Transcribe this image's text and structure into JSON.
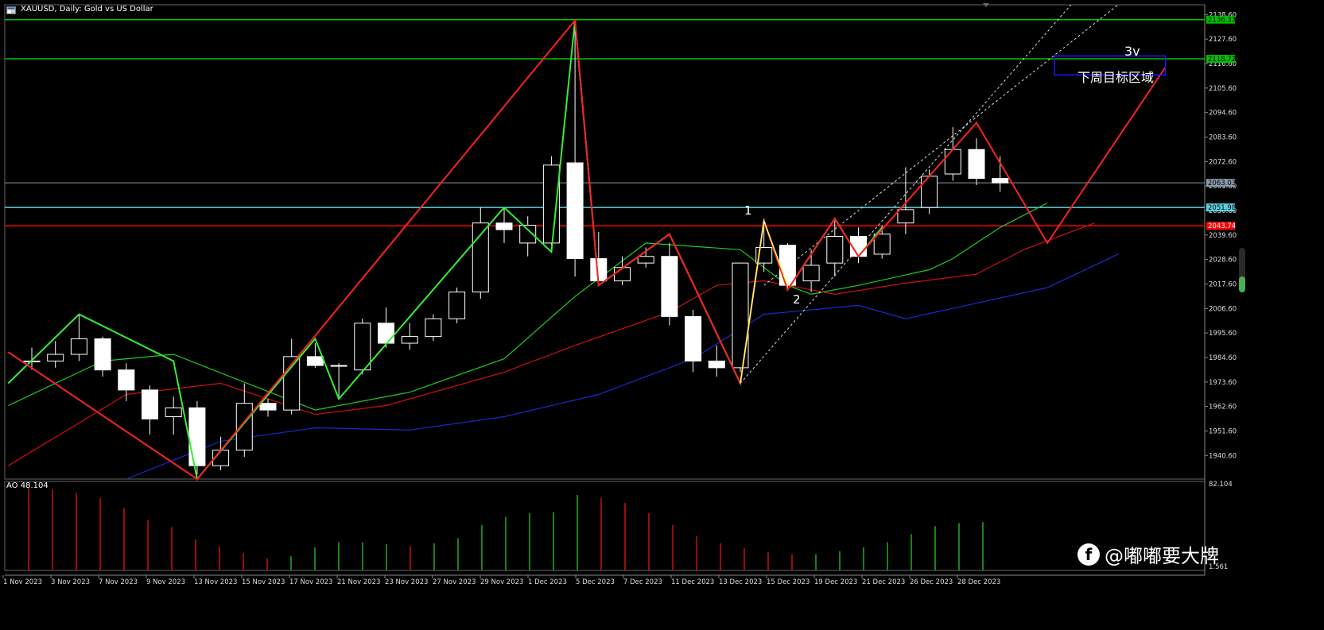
{
  "header": {
    "title": "XAUUSD, Daily:  Gold vs US Dollar",
    "icon": "chart-window-icon"
  },
  "ao_label": "AO 48.104",
  "watermark": {
    "icon": "facebook-icon",
    "text": "@嘟嘟要大牌"
  },
  "annotations": {
    "wave1": "1",
    "wave2": "2",
    "wave3": "3v",
    "target_zone": "下周目标区域"
  },
  "colors": {
    "background": "#000000",
    "grid": "#1a1a1a",
    "bull_candle": "#ffffff",
    "bear_candle": "#ffffff",
    "candle_wick": "#ffffff",
    "zigzag_red": "#ff2020",
    "zigzag_green": "#33ee33",
    "wave_yellow": "#ffff66",
    "ma_fast": "#22cc22",
    "ma_mid": "#cc1111",
    "ma_slow": "#1a2ad0",
    "level_green": "#00c000",
    "level_cyan": "#5ed0e0",
    "level_red": "#ff0000",
    "level_gray": "#8899aa",
    "target_box": "#1a1aff",
    "ao_up": "#22aa22",
    "ao_down": "#cc1111"
  },
  "chart_data": {
    "type": "candlestick",
    "symbol": "XAUUSD",
    "timeframe": "Daily",
    "y_axis": {
      "ylim": [
        1930.0,
        2143.0
      ],
      "ticks": [
        "2138.60",
        "2127.60",
        "2116.60",
        "2105.60",
        "2094.60",
        "2083.60",
        "2072.60",
        "2061.60",
        "2050.60",
        "2039.60",
        "2028.60",
        "2017.60",
        "2006.60",
        "1995.60",
        "1984.60",
        "1973.60",
        "1962.60",
        "1951.60",
        "1940.60"
      ]
    },
    "x_axis_labels": [
      "1 Nov 2023",
      "3 Nov 2023",
      "7 Nov 2023",
      "9 Nov 2023",
      "13 Nov 2023",
      "15 Nov 2023",
      "17 Nov 2023",
      "21 Nov 2023",
      "23 Nov 2023",
      "27 Nov 2023",
      "29 Nov 2023",
      "1 Dec 2023",
      "5 Dec 2023",
      "7 Dec 2023",
      "11 Dec 2023",
      "13 Dec 2023",
      "15 Dec 2023",
      "19 Dec 2023",
      "21 Dec 2023",
      "26 Dec 2023",
      "28 Dec 2023"
    ],
    "horizontal_levels": [
      {
        "label": "2136.33",
        "value": 2136.33,
        "color": "#00c000"
      },
      {
        "label": "2118.72",
        "value": 2118.72,
        "color": "#00c000"
      },
      {
        "label": "2063.03",
        "value": 2063.03,
        "color": "#8899aa"
      },
      {
        "label": "2051.98",
        "value": 2051.98,
        "color": "#5ed0e0"
      },
      {
        "label": "2043.74",
        "value": 2043.74,
        "color": "#ff0000"
      }
    ],
    "candles": [
      {
        "o": 1983,
        "h": 1989,
        "l": 1979,
        "c": 1983
      },
      {
        "o": 1983,
        "h": 1992,
        "l": 1980,
        "c": 1986
      },
      {
        "o": 1986,
        "h": 2004,
        "l": 1983,
        "c": 1993
      },
      {
        "o": 1993,
        "h": 1994,
        "l": 1976,
        "c": 1979
      },
      {
        "o": 1979,
        "h": 1982,
        "l": 1965,
        "c": 1970
      },
      {
        "o": 1970,
        "h": 1972,
        "l": 1950,
        "c": 1957
      },
      {
        "o": 1958,
        "h": 1967,
        "l": 1950,
        "c": 1962
      },
      {
        "o": 1962,
        "h": 1965,
        "l": 1932,
        "c": 1936
      },
      {
        "o": 1936,
        "h": 1949,
        "l": 1934,
        "c": 1943
      },
      {
        "o": 1943,
        "h": 1973,
        "l": 1940,
        "c": 1964
      },
      {
        "o": 1964,
        "h": 1966,
        "l": 1958,
        "c": 1961
      },
      {
        "o": 1961,
        "h": 1993,
        "l": 1959,
        "c": 1985
      },
      {
        "o": 1985,
        "h": 1991,
        "l": 1980,
        "c": 1981
      },
      {
        "o": 1981,
        "h": 1982,
        "l": 1966,
        "c": 1981
      },
      {
        "o": 1979,
        "h": 2002,
        "l": 1977,
        "c": 2000
      },
      {
        "o": 2000,
        "h": 2007,
        "l": 1989,
        "c": 1991
      },
      {
        "o": 1991,
        "h": 2000,
        "l": 1988,
        "c": 1994
      },
      {
        "o": 1994,
        "h": 2004,
        "l": 1992,
        "c": 2002
      },
      {
        "o": 2002,
        "h": 2016,
        "l": 2000,
        "c": 2014
      },
      {
        "o": 2014,
        "h": 2052,
        "l": 2011,
        "c": 2045
      },
      {
        "o": 2045,
        "h": 2052,
        "l": 2036,
        "c": 2042
      },
      {
        "o": 2036,
        "h": 2048,
        "l": 2030,
        "c": 2044
      },
      {
        "o": 2036,
        "h": 2075,
        "l": 2035,
        "c": 2071
      },
      {
        "o": 2072,
        "h": 2136,
        "l": 2021,
        "c": 2029
      },
      {
        "o": 2029,
        "h": 2041,
        "l": 2017,
        "c": 2019
      },
      {
        "o": 2019,
        "h": 2030,
        "l": 2017,
        "c": 2025
      },
      {
        "o": 2027,
        "h": 2034,
        "l": 2025,
        "c": 2030
      },
      {
        "o": 2030,
        "h": 2036,
        "l": 1999,
        "c": 2003
      },
      {
        "o": 2003,
        "h": 2006,
        "l": 1978,
        "c": 1983
      },
      {
        "o": 1983,
        "h": 1990,
        "l": 1976,
        "c": 1980
      },
      {
        "o": 1980,
        "h": 2027,
        "l": 1978,
        "c": 2027
      },
      {
        "o": 2027,
        "h": 2047,
        "l": 2023,
        "c": 2034
      },
      {
        "o": 2035,
        "h": 2036,
        "l": 2015,
        "c": 2017
      },
      {
        "o": 2019,
        "h": 2033,
        "l": 2014,
        "c": 2026
      },
      {
        "o": 2027,
        "h": 2046,
        "l": 2021,
        "c": 2039
      },
      {
        "o": 2039,
        "h": 2043,
        "l": 2027,
        "c": 2030
      },
      {
        "o": 2031,
        "h": 2044,
        "l": 2029,
        "c": 2040
      },
      {
        "o": 2045,
        "h": 2070,
        "l": 2040,
        "c": 2051
      },
      {
        "o": 2052,
        "h": 2069,
        "l": 2049,
        "c": 2066
      },
      {
        "o": 2067,
        "h": 2088,
        "l": 2064,
        "c": 2078
      },
      {
        "o": 2078,
        "h": 2083,
        "l": 2062,
        "c": 2065
      },
      {
        "o": 2065,
        "h": 2075,
        "l": 2059,
        "c": 2063
      }
    ],
    "zigzag": [
      {
        "color": "#33ee33",
        "points": [
          [
            -1,
            1973
          ],
          [
            2,
            2004
          ],
          [
            6,
            1983
          ],
          [
            7,
            1930
          ],
          [
            12,
            1993
          ],
          [
            13,
            1966
          ],
          [
            20,
            2052
          ],
          [
            22,
            2032
          ],
          [
            23,
            2136
          ],
          [
            24,
            2017
          ],
          [
            27,
            2040
          ],
          [
            30,
            1973
          ],
          [
            31,
            2046
          ],
          [
            32,
            2015
          ],
          [
            34,
            2047
          ],
          [
            35,
            2030
          ],
          [
            36,
            2043
          ]
        ]
      },
      {
        "color": "#ff2020",
        "points": [
          [
            -1,
            1987
          ],
          [
            7,
            1930
          ],
          [
            23,
            2136
          ],
          [
            24,
            2017
          ],
          [
            27,
            2040
          ],
          [
            30,
            1973
          ],
          [
            31,
            2046
          ],
          [
            32,
            2015
          ],
          [
            34,
            2047
          ],
          [
            35,
            2030
          ],
          [
            40,
            2090
          ],
          [
            43,
            2036
          ],
          [
            48,
            2115
          ]
        ]
      }
    ],
    "moving_averages": [
      {
        "color": "#22cc22",
        "points": [
          [
            -1,
            1963
          ],
          [
            3,
            1983
          ],
          [
            6,
            1986
          ],
          [
            12,
            1961
          ],
          [
            16,
            1969
          ],
          [
            20,
            1984
          ],
          [
            23,
            2012
          ],
          [
            26,
            2036
          ],
          [
            30,
            2033
          ],
          [
            32,
            2017
          ],
          [
            33,
            2013
          ],
          [
            35,
            2017
          ],
          [
            38,
            2024
          ],
          [
            39,
            2029
          ],
          [
            41,
            2043
          ],
          [
            43,
            2054
          ]
        ]
      },
      {
        "color": "#cc1111",
        "points": [
          [
            -1,
            1936
          ],
          [
            4,
            1968
          ],
          [
            8,
            1973
          ],
          [
            12,
            1959
          ],
          [
            15,
            1963
          ],
          [
            20,
            1978
          ],
          [
            23,
            1990
          ],
          [
            27,
            2005
          ],
          [
            29,
            2017
          ],
          [
            31,
            2019
          ],
          [
            34,
            2013
          ],
          [
            37,
            2018
          ],
          [
            40,
            2022
          ],
          [
            42,
            2033
          ],
          [
            45,
            2045
          ]
        ]
      },
      {
        "color": "#1a2ad0",
        "points": [
          [
            4,
            1930
          ],
          [
            8,
            1947
          ],
          [
            12,
            1953
          ],
          [
            16,
            1952
          ],
          [
            20,
            1958
          ],
          [
            24,
            1968
          ],
          [
            28,
            1984
          ],
          [
            31,
            2004
          ],
          [
            35,
            2008
          ],
          [
            37,
            2002
          ],
          [
            40,
            2009
          ],
          [
            43,
            2016
          ],
          [
            46,
            2031
          ]
        ]
      }
    ],
    "channel_lines": [
      [
        [
          30,
          1973
        ],
        [
          44,
          2143
        ]
      ],
      [
        [
          31,
          2017
        ],
        [
          46,
          2143
        ]
      ]
    ],
    "target_box": {
      "x0": 43.3,
      "x1": 48.0,
      "y0": 2111.5,
      "y1": 2120.0
    },
    "ao": {
      "label": "AO 48.104",
      "ticks": [
        "82.104",
        "1.561"
      ],
      "ylim": [
        0,
        82.104
      ],
      "bars": [
        {
          "v": 82,
          "c": "r"
        },
        {
          "v": 80,
          "c": "r"
        },
        {
          "v": 77,
          "c": "r"
        },
        {
          "v": 72,
          "c": "r"
        },
        {
          "v": 62,
          "c": "r"
        },
        {
          "v": 50,
          "c": "r"
        },
        {
          "v": 43,
          "c": "r"
        },
        {
          "v": 31,
          "c": "r"
        },
        {
          "v": 24,
          "c": "r"
        },
        {
          "v": 17,
          "c": "r"
        },
        {
          "v": 12,
          "c": "r"
        },
        {
          "v": 14,
          "c": "g"
        },
        {
          "v": 23,
          "c": "g"
        },
        {
          "v": 28,
          "c": "g"
        },
        {
          "v": 28,
          "c": "g"
        },
        {
          "v": 26,
          "c": "g"
        },
        {
          "v": 24,
          "c": "r"
        },
        {
          "v": 27,
          "c": "g"
        },
        {
          "v": 32,
          "c": "g"
        },
        {
          "v": 45,
          "c": "g"
        },
        {
          "v": 53,
          "c": "g"
        },
        {
          "v": 57,
          "c": "g"
        },
        {
          "v": 58,
          "c": "g"
        },
        {
          "v": 75,
          "c": "g"
        },
        {
          "v": 72,
          "c": "r"
        },
        {
          "v": 67,
          "c": "r"
        },
        {
          "v": 57,
          "c": "r"
        },
        {
          "v": 45,
          "c": "r"
        },
        {
          "v": 34,
          "c": "r"
        },
        {
          "v": 27,
          "c": "r"
        },
        {
          "v": 22,
          "c": "r"
        },
        {
          "v": 18,
          "c": "r"
        },
        {
          "v": 16,
          "c": "r"
        },
        {
          "v": 16,
          "c": "g"
        },
        {
          "v": 19,
          "c": "g"
        },
        {
          "v": 23,
          "c": "g"
        },
        {
          "v": 28,
          "c": "g"
        },
        {
          "v": 36,
          "c": "g"
        },
        {
          "v": 44,
          "c": "g"
        },
        {
          "v": 47,
          "c": "g"
        },
        {
          "v": 48,
          "c": "g"
        }
      ]
    }
  }
}
